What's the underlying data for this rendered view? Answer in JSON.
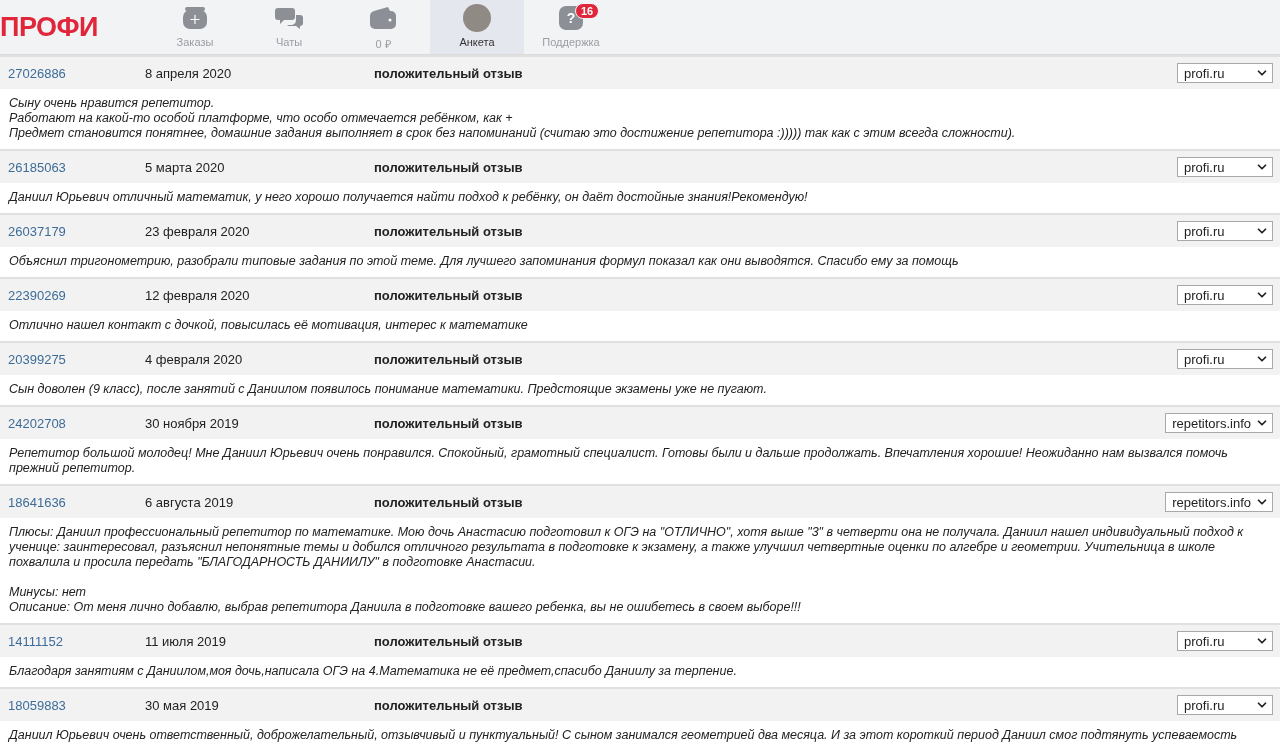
{
  "header": {
    "logo": "ПРОФИ",
    "nav": [
      {
        "kind": "orders",
        "label": "Заказы",
        "selected": false
      },
      {
        "kind": "chats",
        "label": "Чаты",
        "selected": false
      },
      {
        "kind": "wallet",
        "label": "0 ₽",
        "selected": false
      },
      {
        "kind": "profile",
        "label": "Анкета",
        "selected": true
      },
      {
        "kind": "support",
        "label": "Поддержка",
        "selected": false,
        "badge": "16",
        "glyph": "?"
      }
    ]
  },
  "reviews": [
    {
      "id": "27026886",
      "date": "8 апреля 2020",
      "type": "положительный отзыв",
      "source": "profi.ru",
      "text": "Сыну очень нравится репетитор.\nРаботают на какой-то особой платформе, что особо отмечается ребёнком, как +\nПредмет становится понятнее, домашние задания выполняет в срок без напоминаний (считаю это достижение репетитора :))))) так как с этим всегда сложности)."
    },
    {
      "id": "26185063",
      "date": "5 марта 2020",
      "type": "положительный отзыв",
      "source": "profi.ru",
      "text": "Даниил Юрьевич отличный математик, у него хорошо получается найти подход к ребёнку, он даёт достойные знания!Рекомендую!"
    },
    {
      "id": "26037179",
      "date": "23 февраля 2020",
      "type": "положительный отзыв",
      "source": "profi.ru",
      "text": "Объяснил тригонометрию, разобрали типовые задания по этой теме. Для лучшего запоминания формул показал как они выводятся. Спасибо ему за помощь"
    },
    {
      "id": "22390269",
      "date": "12 февраля 2020",
      "type": "положительный отзыв",
      "source": "profi.ru",
      "text": "Отлично нашел контакт с дочкой, повысилась её мотивация, интерес к математике"
    },
    {
      "id": "20399275",
      "date": "4 февраля 2020",
      "type": "положительный отзыв",
      "source": "profi.ru",
      "text": "Сын доволен (9 класс), после занятий с Даниилом появилось понимание математики. Предстоящие экзамены уже не пугают."
    },
    {
      "id": "24202708",
      "date": "30 ноября 2019",
      "type": "положительный отзыв",
      "source": "repetitors.info",
      "text": "Репетитор большой молодец! Мне Даниил Юрьевич очень понравился. Спокойный, грамотный специалист. Готовы были и дальше продолжать. Впечатления хорошие! Неожиданно нам вызвался помочь прежний репетитор."
    },
    {
      "id": "18641636",
      "date": "6 августа 2019",
      "type": "положительный отзыв",
      "source": "repetitors.info",
      "text": "Плюсы: Даниил профессиональный репетитор по математике. Мою дочь Анастасию подготовил к ОГЭ на \"ОТЛИЧНО\", хотя выше \"3\" в четверти она не получала. Даниил нашел индивидуальный подход к ученице: заинтересовал, разъяснил непонятные темы и добился отличного результата в подготовке к экзамену, а также улучшил четвертные оценки по алгебре и геометрии. Учительница в школе похвалила и просила передать \"БЛАГОДАРНОСТЬ ДАНИИЛУ\" в подготовке Анастасии.\n\nМинусы: нет\nОписание: От меня лично добавлю, выбрав репетитора Даниила в подготовке вашего ребенка, вы не ошибетесь в своем выборе!!!"
    },
    {
      "id": "14111152",
      "date": "11 июля 2019",
      "type": "положительный отзыв",
      "source": "profi.ru",
      "text": "Благодаря занятиям с Даниилом,моя дочь,написала ОГЭ на 4.Математика не её предмет,спасибо Даниилу за терпение."
    },
    {
      "id": "18059883",
      "date": "30 мая 2019",
      "type": "положительный отзыв",
      "source": "profi.ru",
      "text": "Даниил Юрьевич очень ответственный, доброжелательный, отзывчивый и пунктуальный! С сыном занимался геометрией два месяца. И за этот короткий период Даниил смог подтянуть успеваемость"
    }
  ]
}
